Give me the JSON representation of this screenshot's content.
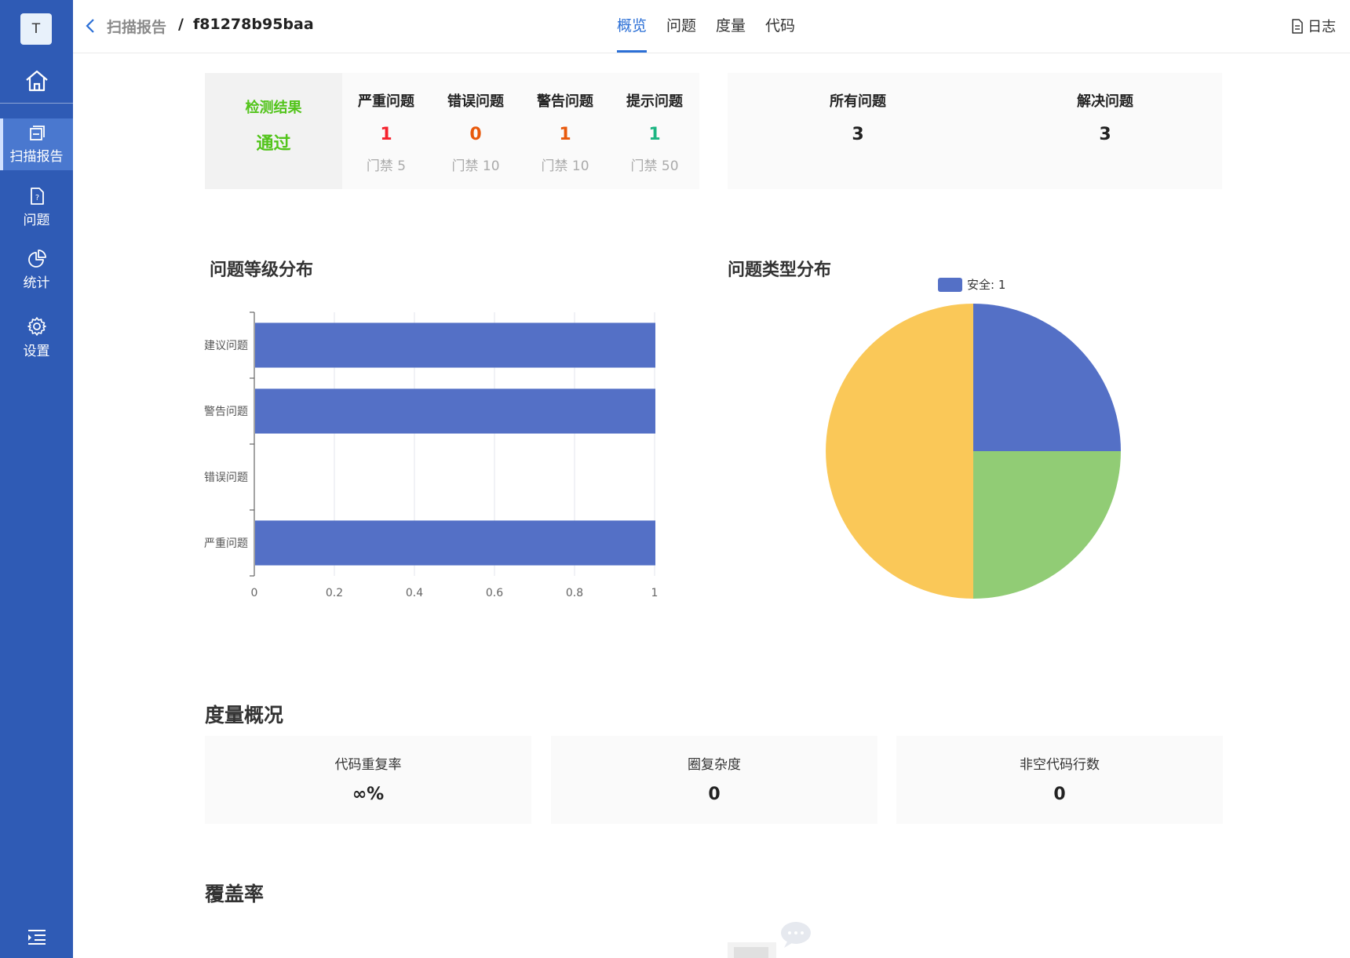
{
  "sidebar": {
    "avatar_letter": "T",
    "items": [
      {
        "label": "扫描报告",
        "icon": "report-icon",
        "active": true
      },
      {
        "label": "问题",
        "icon": "issue-file-icon",
        "active": false
      },
      {
        "label": "统计",
        "icon": "pie-chart-icon",
        "active": false
      },
      {
        "label": "设置",
        "icon": "gear-icon",
        "active": false
      }
    ]
  },
  "header": {
    "breadcrumb_parent": "扫描报告",
    "breadcrumb_sep": "/",
    "breadcrumb_current": "f81278b95baa",
    "tabs": [
      {
        "label": "概览",
        "active": true
      },
      {
        "label": "问题",
        "active": false
      },
      {
        "label": "度量",
        "active": false
      },
      {
        "label": "代码",
        "active": false
      }
    ],
    "log_label": "日志"
  },
  "result": {
    "label": "检测结果",
    "value": "通过",
    "severities": [
      {
        "label": "严重问题",
        "count": "1",
        "gate": "门禁 5",
        "color": "#f5222d"
      },
      {
        "label": "错误问题",
        "count": "0",
        "gate": "门禁 10",
        "color": "#e8590c"
      },
      {
        "label": "警告问题",
        "count": "1",
        "gate": "门禁 10",
        "color": "#e8590c"
      },
      {
        "label": "提示问题",
        "count": "1",
        "gate": "门禁 50",
        "color": "#1cb582"
      }
    ]
  },
  "totals": [
    {
      "label": "所有问题",
      "count": "3"
    },
    {
      "label": "解决问题",
      "count": "3"
    }
  ],
  "charts": {
    "level_title": "问题等级分布",
    "type_title": "问题类型分布",
    "pie_legend": "安全: 1"
  },
  "chart_data": [
    {
      "type": "bar",
      "orientation": "horizontal",
      "title": "问题等级分布",
      "categories": [
        "严重问题",
        "错误问题",
        "警告问题",
        "建议问题"
      ],
      "values": [
        1,
        0,
        1,
        1
      ],
      "xlim": [
        0,
        1
      ],
      "x_ticks": [
        "0",
        "0.2",
        "0.4",
        "0.6",
        "0.8",
        "1"
      ],
      "grid": true,
      "color": "#5470c6"
    },
    {
      "type": "pie",
      "title": "问题类型分布",
      "legend": [
        "安全: 1"
      ],
      "legend_position": "top",
      "slices": [
        {
          "value": 1,
          "color": "#5470c6"
        },
        {
          "value": 1,
          "color": "#91cc75"
        },
        {
          "value": 2,
          "color": "#fac858"
        }
      ]
    }
  ],
  "metrics": {
    "title": "度量概况",
    "items": [
      {
        "label": "代码重复率",
        "value": "∞%"
      },
      {
        "label": "圈复杂度",
        "value": "0"
      },
      {
        "label": "非空代码行数",
        "value": "0"
      }
    ]
  },
  "coverage": {
    "title": "覆盖率"
  }
}
